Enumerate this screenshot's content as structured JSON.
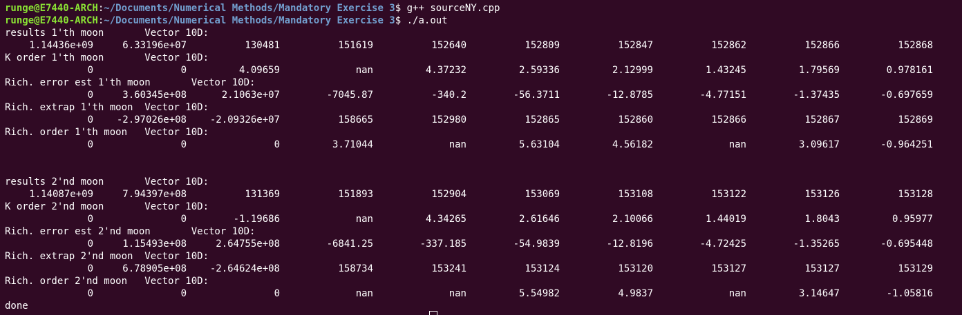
{
  "prompt": {
    "user": "runge@E7440-ARCH",
    "path": "~/Documents/Numerical Methods/Mandatory Exercise 3",
    "symbol": "$"
  },
  "commands": [
    "g++ sourceNY.cpp",
    "./a.out"
  ],
  "blocks": [
    {
      "header": "results 1'th moon       Vector 10D:",
      "values": [
        "1.14436e+09",
        "6.33196e+07",
        "130481",
        "151619",
        "152640",
        "152809",
        "152847",
        "152862",
        "152866",
        "152868"
      ]
    },
    {
      "header": "K order 1'th moon       Vector 10D:",
      "values": [
        "0",
        "0",
        "4.09659",
        "nan",
        "4.37232",
        "2.59336",
        "2.12999",
        "1.43245",
        "1.79569",
        "0.978161"
      ]
    },
    {
      "header": "Rich. error est 1'th moon       Vector 10D:",
      "values": [
        "0",
        "3.60345e+08",
        "2.1063e+07",
        "-7045.87",
        "-340.2",
        "-56.3711",
        "-12.8785",
        "-4.77151",
        "-1.37435",
        "-0.697659"
      ]
    },
    {
      "header": "Rich. extrap 1'th moon  Vector 10D:",
      "values": [
        "0",
        "-2.97026e+08",
        "-2.09326e+07",
        "158665",
        "152980",
        "152865",
        "152860",
        "152866",
        "152867",
        "152869"
      ]
    },
    {
      "header": "Rich. order 1'th moon   Vector 10D:",
      "values": [
        "0",
        "0",
        "0",
        "3.71044",
        "nan",
        "5.63104",
        "4.56182",
        "nan",
        "3.09617",
        "-0.964251"
      ]
    },
    {
      "header": "results 2'nd moon       Vector 10D:",
      "values": [
        "1.14087e+09",
        "7.94397e+08",
        "131369",
        "151893",
        "152904",
        "153069",
        "153108",
        "153122",
        "153126",
        "153128"
      ]
    },
    {
      "header": "K order 2'nd moon       Vector 10D:",
      "values": [
        "0",
        "0",
        "-1.19686",
        "nan",
        "4.34265",
        "2.61646",
        "2.10066",
        "1.44019",
        "1.8043",
        "0.95977"
      ]
    },
    {
      "header": "Rich. error est 2'nd moon       Vector 10D:",
      "values": [
        "0",
        "1.15493e+08",
        "2.64755e+08",
        "-6841.25",
        "-337.185",
        "-54.9839",
        "-12.8196",
        "-4.72425",
        "-1.35265",
        "-0.695448"
      ]
    },
    {
      "header": "Rich. extrap 2'nd moon  Vector 10D:",
      "values": [
        "0",
        "6.78905e+08",
        "-2.64624e+08",
        "158734",
        "153241",
        "153124",
        "153120",
        "153127",
        "153127",
        "153129"
      ]
    },
    {
      "header": "Rich. order 2'nd moon   Vector 10D:",
      "values": [
        "0",
        "0",
        "0",
        "nan",
        "nan",
        "5.54982",
        "4.9837",
        "nan",
        "3.14647",
        "-1.05816"
      ]
    }
  ],
  "footer": "done",
  "colors": {
    "background": "#300a24",
    "user": "#8ae234",
    "path": "#729fcf",
    "text": "#ffffff"
  }
}
